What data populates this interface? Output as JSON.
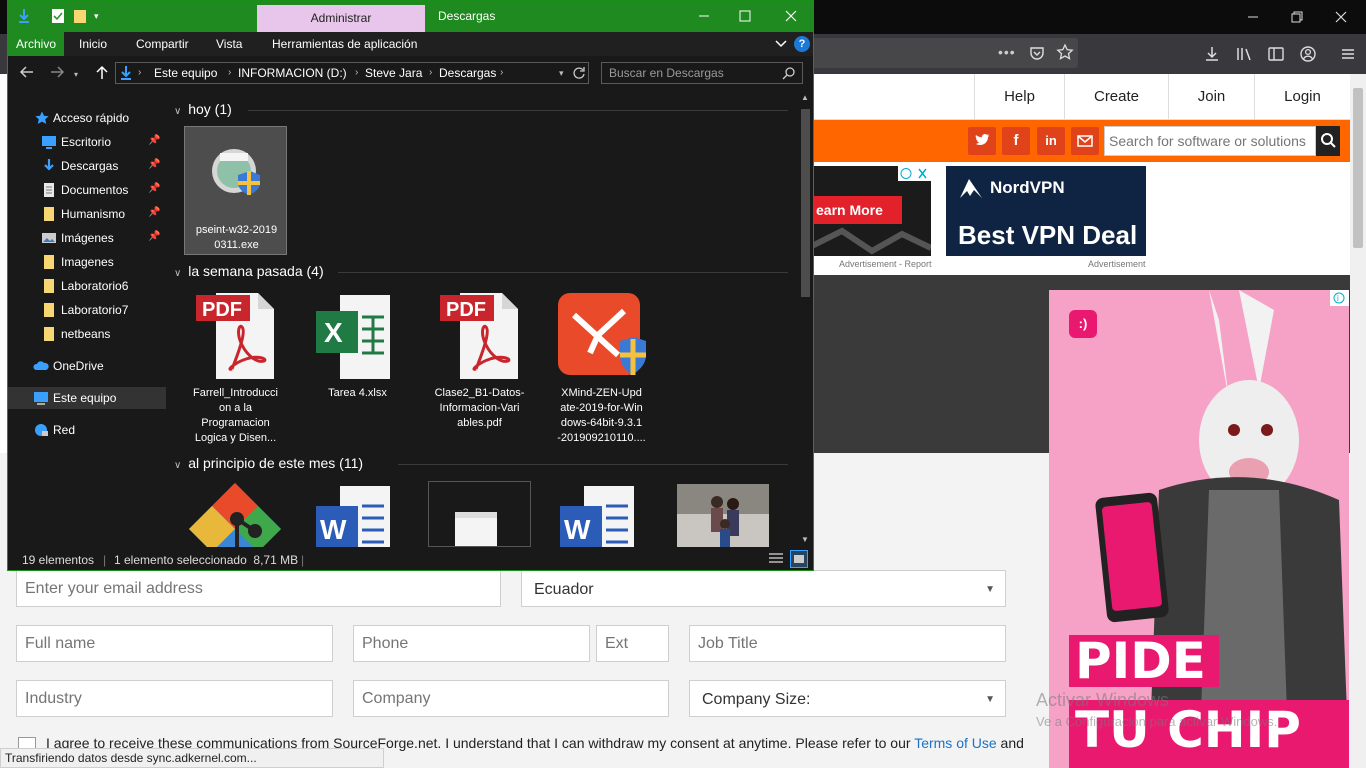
{
  "explorer": {
    "title_context": "Administrar",
    "title_folder": "Descargas",
    "ribbon_tabs": [
      "Archivo",
      "Inicio",
      "Compartir",
      "Vista",
      "Herramientas de aplicación"
    ],
    "breadcrumb": [
      "Este equipo",
      "INFORMACION (D:)",
      "Steve Jara",
      "Descargas"
    ],
    "search_placeholder": "Buscar en Descargas",
    "nav": [
      {
        "label": "Acceso rápido",
        "icon": "star-icon"
      },
      {
        "label": "Escritorio",
        "icon": "desktop-icon",
        "pinned": true
      },
      {
        "label": "Descargas",
        "icon": "download-icon",
        "pinned": true
      },
      {
        "label": "Documentos",
        "icon": "document-icon",
        "pinned": true
      },
      {
        "label": "Humanismo",
        "icon": "folder-icon",
        "pinned": true
      },
      {
        "label": "Imágenes",
        "icon": "pictures-icon",
        "pinned": true
      },
      {
        "label": "Imagenes",
        "icon": "folder-icon"
      },
      {
        "label": "Laboratorio6",
        "icon": "folder-icon"
      },
      {
        "label": "Laboratorio7",
        "icon": "folder-icon"
      },
      {
        "label": "netbeans",
        "icon": "folder-icon"
      },
      {
        "label": "OneDrive",
        "icon": "cloud-icon"
      },
      {
        "label": "Este equipo",
        "icon": "computer-icon"
      },
      {
        "label": "Red",
        "icon": "network-icon"
      }
    ],
    "groups": [
      {
        "title": "hoy (1)",
        "files": [
          {
            "name": "pseint-w32-2019\n0311.exe",
            "icon": "installer-icon",
            "selected": true
          }
        ]
      },
      {
        "title": "la semana pasada (4)",
        "files": [
          {
            "name": "Farrell_Introducci\non a la\nProgramacion\nLogica y Disen...",
            "icon": "pdf-icon"
          },
          {
            "name": "Tarea 4.xlsx",
            "icon": "excel-icon"
          },
          {
            "name": "Clase2_B1-Datos-\nInformacion-Vari\nables.pdf",
            "icon": "pdf-icon"
          },
          {
            "name": "XMind-ZEN-Upd\nate-2019-for-Win\ndows-64bit-9.3.1\n-201909210110....",
            "icon": "xmind-icon"
          }
        ]
      },
      {
        "title": "al principio de este mes (11)",
        "files": []
      }
    ],
    "status": {
      "count": "19 elementos",
      "selection": "1 elemento seleccionado  8,71 MB"
    }
  },
  "browser": {
    "nav": [
      "Help",
      "Create",
      "Join",
      "Login"
    ],
    "search_placeholder": "Search for software or solutions",
    "ads": {
      "ad1_button": "earn More",
      "ad1_label": "Advertisement - Report",
      "ad2_brand": "NordVPN",
      "ad2_headline": "Best VPN Deal",
      "ad2_label": "Advertisement",
      "ad3_line1": "PIDE",
      "ad3_line2": "TU CHIP"
    },
    "form": {
      "email_placeholder": "Enter your email address",
      "country_value": "Ecuador",
      "fullname_placeholder": "Full name",
      "phone_placeholder": "Phone",
      "ext_placeholder": "Ext",
      "jobtitle_placeholder": "Job Title",
      "industry_placeholder": "Industry",
      "company_placeholder": "Company",
      "company_size_value": "Company Size:",
      "agree_text": "I agree to receive these communications from SourceForge.net. I understand that I can withdraw my consent at anytime. Please refer to our",
      "agree_link": "Terms of Use",
      "agree_tail": "and"
    },
    "watermark_title": "Activar Windows",
    "watermark_sub": "Ve a Configuración para activar Windows.",
    "status_text": "Transfiriendo datos desde sync.adkernel.com..."
  }
}
